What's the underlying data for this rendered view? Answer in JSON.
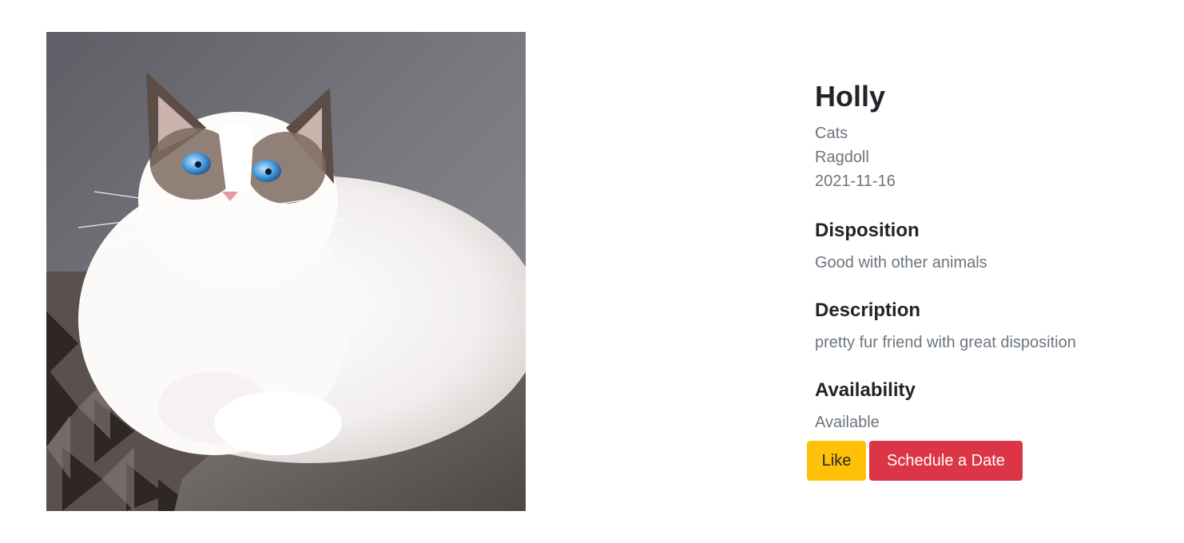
{
  "pet": {
    "name": "Holly",
    "type": "Cats",
    "breed": "Ragdoll",
    "date": "2021-11-16"
  },
  "sections": {
    "disposition": {
      "title": "Disposition",
      "text": "Good with other animals"
    },
    "description": {
      "title": "Description",
      "text": "pretty fur friend with great disposition"
    },
    "availability": {
      "title": "Availability",
      "text": "Available"
    }
  },
  "actions": {
    "like_label": "Like",
    "schedule_label": "Schedule a Date"
  },
  "colors": {
    "like": "#ffc107",
    "schedule": "#dc3545",
    "heading": "#212529",
    "muted": "#6c757d"
  }
}
